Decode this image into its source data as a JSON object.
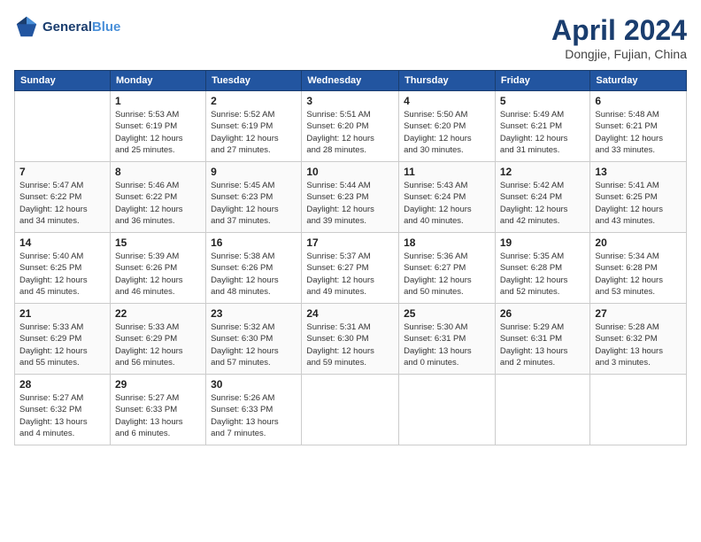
{
  "header": {
    "logo_line1": "General",
    "logo_line2": "Blue",
    "month_title": "April 2024",
    "location": "Dongjie, Fujian, China"
  },
  "weekdays": [
    "Sunday",
    "Monday",
    "Tuesday",
    "Wednesday",
    "Thursday",
    "Friday",
    "Saturday"
  ],
  "weeks": [
    [
      {
        "day": "",
        "info": ""
      },
      {
        "day": "1",
        "info": "Sunrise: 5:53 AM\nSunset: 6:19 PM\nDaylight: 12 hours\nand 25 minutes."
      },
      {
        "day": "2",
        "info": "Sunrise: 5:52 AM\nSunset: 6:19 PM\nDaylight: 12 hours\nand 27 minutes."
      },
      {
        "day": "3",
        "info": "Sunrise: 5:51 AM\nSunset: 6:20 PM\nDaylight: 12 hours\nand 28 minutes."
      },
      {
        "day": "4",
        "info": "Sunrise: 5:50 AM\nSunset: 6:20 PM\nDaylight: 12 hours\nand 30 minutes."
      },
      {
        "day": "5",
        "info": "Sunrise: 5:49 AM\nSunset: 6:21 PM\nDaylight: 12 hours\nand 31 minutes."
      },
      {
        "day": "6",
        "info": "Sunrise: 5:48 AM\nSunset: 6:21 PM\nDaylight: 12 hours\nand 33 minutes."
      }
    ],
    [
      {
        "day": "7",
        "info": "Sunrise: 5:47 AM\nSunset: 6:22 PM\nDaylight: 12 hours\nand 34 minutes."
      },
      {
        "day": "8",
        "info": "Sunrise: 5:46 AM\nSunset: 6:22 PM\nDaylight: 12 hours\nand 36 minutes."
      },
      {
        "day": "9",
        "info": "Sunrise: 5:45 AM\nSunset: 6:23 PM\nDaylight: 12 hours\nand 37 minutes."
      },
      {
        "day": "10",
        "info": "Sunrise: 5:44 AM\nSunset: 6:23 PM\nDaylight: 12 hours\nand 39 minutes."
      },
      {
        "day": "11",
        "info": "Sunrise: 5:43 AM\nSunset: 6:24 PM\nDaylight: 12 hours\nand 40 minutes."
      },
      {
        "day": "12",
        "info": "Sunrise: 5:42 AM\nSunset: 6:24 PM\nDaylight: 12 hours\nand 42 minutes."
      },
      {
        "day": "13",
        "info": "Sunrise: 5:41 AM\nSunset: 6:25 PM\nDaylight: 12 hours\nand 43 minutes."
      }
    ],
    [
      {
        "day": "14",
        "info": "Sunrise: 5:40 AM\nSunset: 6:25 PM\nDaylight: 12 hours\nand 45 minutes."
      },
      {
        "day": "15",
        "info": "Sunrise: 5:39 AM\nSunset: 6:26 PM\nDaylight: 12 hours\nand 46 minutes."
      },
      {
        "day": "16",
        "info": "Sunrise: 5:38 AM\nSunset: 6:26 PM\nDaylight: 12 hours\nand 48 minutes."
      },
      {
        "day": "17",
        "info": "Sunrise: 5:37 AM\nSunset: 6:27 PM\nDaylight: 12 hours\nand 49 minutes."
      },
      {
        "day": "18",
        "info": "Sunrise: 5:36 AM\nSunset: 6:27 PM\nDaylight: 12 hours\nand 50 minutes."
      },
      {
        "day": "19",
        "info": "Sunrise: 5:35 AM\nSunset: 6:28 PM\nDaylight: 12 hours\nand 52 minutes."
      },
      {
        "day": "20",
        "info": "Sunrise: 5:34 AM\nSunset: 6:28 PM\nDaylight: 12 hours\nand 53 minutes."
      }
    ],
    [
      {
        "day": "21",
        "info": "Sunrise: 5:33 AM\nSunset: 6:29 PM\nDaylight: 12 hours\nand 55 minutes."
      },
      {
        "day": "22",
        "info": "Sunrise: 5:33 AM\nSunset: 6:29 PM\nDaylight: 12 hours\nand 56 minutes."
      },
      {
        "day": "23",
        "info": "Sunrise: 5:32 AM\nSunset: 6:30 PM\nDaylight: 12 hours\nand 57 minutes."
      },
      {
        "day": "24",
        "info": "Sunrise: 5:31 AM\nSunset: 6:30 PM\nDaylight: 12 hours\nand 59 minutes."
      },
      {
        "day": "25",
        "info": "Sunrise: 5:30 AM\nSunset: 6:31 PM\nDaylight: 13 hours\nand 0 minutes."
      },
      {
        "day": "26",
        "info": "Sunrise: 5:29 AM\nSunset: 6:31 PM\nDaylight: 13 hours\nand 2 minutes."
      },
      {
        "day": "27",
        "info": "Sunrise: 5:28 AM\nSunset: 6:32 PM\nDaylight: 13 hours\nand 3 minutes."
      }
    ],
    [
      {
        "day": "28",
        "info": "Sunrise: 5:27 AM\nSunset: 6:32 PM\nDaylight: 13 hours\nand 4 minutes."
      },
      {
        "day": "29",
        "info": "Sunrise: 5:27 AM\nSunset: 6:33 PM\nDaylight: 13 hours\nand 6 minutes."
      },
      {
        "day": "30",
        "info": "Sunrise: 5:26 AM\nSunset: 6:33 PM\nDaylight: 13 hours\nand 7 minutes."
      },
      {
        "day": "",
        "info": ""
      },
      {
        "day": "",
        "info": ""
      },
      {
        "day": "",
        "info": ""
      },
      {
        "day": "",
        "info": ""
      }
    ]
  ]
}
